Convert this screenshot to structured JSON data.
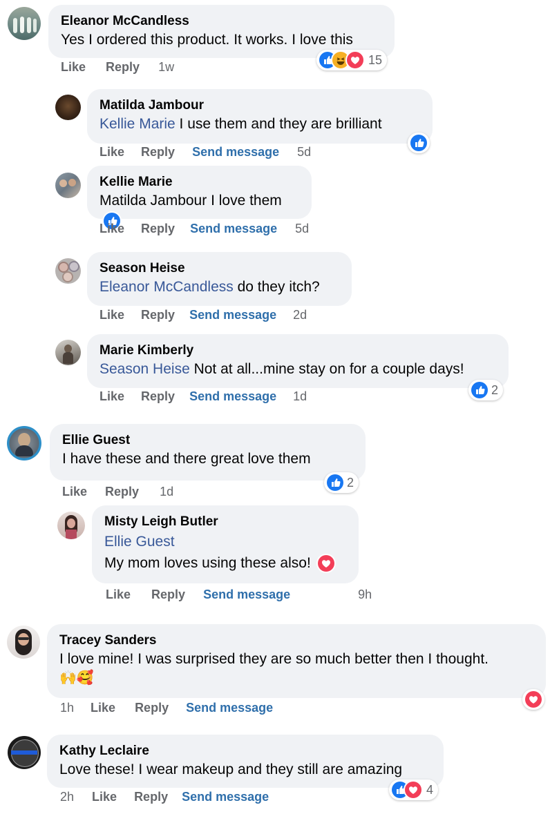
{
  "comments": [
    {
      "author": "Eleanor McCandless",
      "text": "Yes I ordered this product. It works. I love this",
      "actions": {
        "like": "Like",
        "reply": "Reply",
        "time": "1w"
      },
      "reactions": {
        "icons": [
          "like",
          "haha",
          "love"
        ],
        "count": "15"
      }
    },
    {
      "author": "Matilda Jambour",
      "mention": "Kellie Marie",
      "text": " I use them and they are brilliant",
      "actions": {
        "like": "Like",
        "reply": "Reply",
        "send": "Send message",
        "time": "5d"
      },
      "reactions": {
        "icons": [
          "like"
        ]
      }
    },
    {
      "author": "Kellie Marie",
      "text": "Matilda Jambour I love them",
      "actions": {
        "like": "Like",
        "reply": "Reply",
        "send": "Send message",
        "time": "5d"
      },
      "reactions": {
        "icons": [
          "like"
        ]
      }
    },
    {
      "author": "Season Heise",
      "mention": "Eleanor McCandless",
      "text": " do they itch?",
      "actions": {
        "like": "Like",
        "reply": "Reply",
        "send": "Send message",
        "time": "2d"
      }
    },
    {
      "author": "Marie Kimberly",
      "mention": "Season Heise",
      "text": " Not at all...mine stay on for a couple days!",
      "actions": {
        "like": "Like",
        "reply": "Reply",
        "send": "Send message",
        "time": "1d"
      },
      "reactions": {
        "icons": [
          "like"
        ],
        "count": "2"
      }
    },
    {
      "author": "Ellie Guest",
      "text": "I have these and there great love them",
      "actions": {
        "like": "Like",
        "reply": "Reply",
        "time": "1d"
      },
      "reactions": {
        "icons": [
          "like"
        ],
        "count": "2"
      }
    },
    {
      "author": "Misty Leigh Butler",
      "mention": "Ellie Guest",
      "text": "My mom loves using these also!",
      "actions": {
        "like": "Like",
        "reply": "Reply",
        "send": "Send message",
        "time": "9h"
      },
      "reactions": {
        "icons": [
          "love"
        ]
      }
    },
    {
      "author": "Tracey Sanders",
      "text": "I love mine! I was surprised they are so much better then I thought.",
      "emoji": "🙌🥰",
      "actions": {
        "time": "1h",
        "like": "Like",
        "reply": "Reply",
        "send": "Send message"
      },
      "reactions": {
        "icons": [
          "love"
        ]
      }
    },
    {
      "author": "Kathy Leclaire",
      "text": "Love these! I wear makeup and they still are amazing",
      "actions": {
        "time": "2h",
        "like": "Like",
        "reply": "Reply",
        "send": "Send message"
      },
      "reactions": {
        "icons": [
          "like",
          "love"
        ],
        "count": "4"
      }
    }
  ],
  "colors": {
    "bubble": "#f0f2f5",
    "mention": "#385898",
    "action": "#65676b",
    "send": "#2f6fab",
    "like": "#1877f2",
    "love": "#f33e58",
    "haha": "#f7b125"
  }
}
